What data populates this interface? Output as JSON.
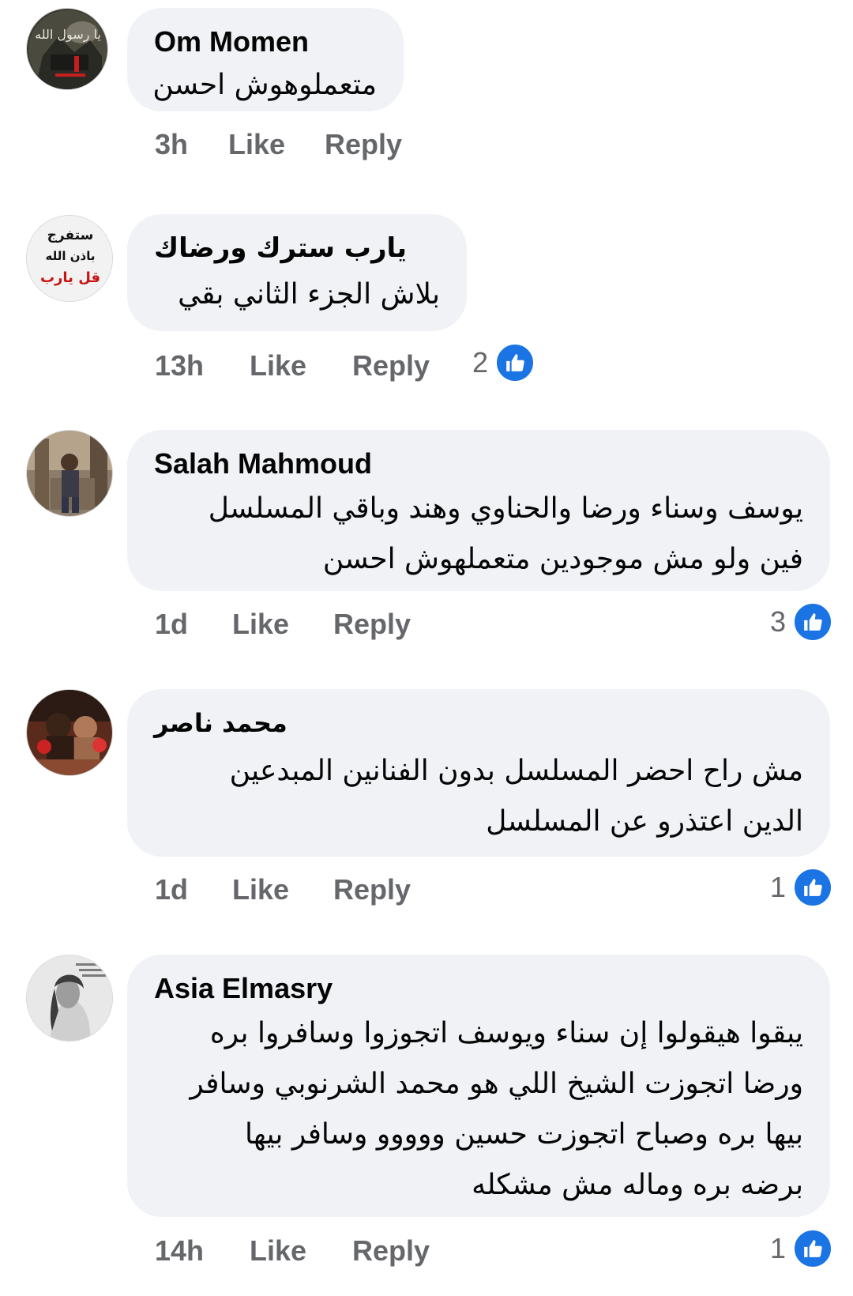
{
  "action_labels": {
    "like": "Like",
    "reply": "Reply"
  },
  "colors": {
    "bubble_bg": "#f0f2f5",
    "meta_text": "#65676b",
    "like_blue": "#1b74e4"
  },
  "comments": [
    {
      "author": "Om Momen",
      "lines": [
        "متعملوهوش احسن"
      ],
      "time": "3h",
      "reactions": null,
      "avatar_text": "يا رسول الله"
    },
    {
      "author": "يارب سترك ورضاك",
      "lines": [
        "بلاش الجزء الثاني بقي"
      ],
      "time": "13h",
      "reactions": "2",
      "avatar_text": [
        "ستفرج",
        "باذن الله",
        "قل يارب"
      ]
    },
    {
      "author": "Salah Mahmoud",
      "lines": [
        "يوسف وسناء ورضا والحناوي وهند وباقي المسلسل",
        "فين ولو مش موجودين متعملهوش احسن"
      ],
      "time": "1d",
      "reactions": "3"
    },
    {
      "author": "محمد ناصر",
      "lines": [
        "مش راح احضر المسلسل بدون الفنانين المبدعين",
        "الدين اعتذرو عن المسلسل"
      ],
      "time": "1d",
      "reactions": "1"
    },
    {
      "author": "Asia Elmasry",
      "lines": [
        "يبقوا هيقولوا إن سناء ويوسف اتجوزوا وسافروا بره",
        "ورضا اتجوزت الشيخ اللي هو محمد الشرنوبي وسافر",
        "بيها بره وصباح اتجوزت حسين ووووو وسافر بيها",
        "برضه بره وماله مش مشكله"
      ],
      "time": "14h",
      "reactions": "1"
    }
  ]
}
